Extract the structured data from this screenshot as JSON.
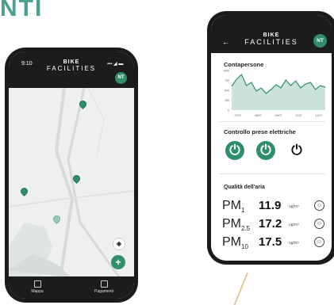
{
  "heading": "NTI",
  "phone1": {
    "time": "9:10",
    "logo_top": "BIKE",
    "logo_bottom": "FACILITIES",
    "avatar": "NT",
    "tabs": [
      {
        "label": "Mappa",
        "icon": "map-icon"
      },
      {
        "label": "Pagamenti",
        "icon": "card-icon"
      }
    ]
  },
  "phone2": {
    "logo_top": "BIKE",
    "logo_bottom": "FACILITIES",
    "avatar": "NT",
    "contapersone": {
      "title": "Contapersone",
      "chart_data": {
        "type": "area",
        "title": "Contapersone",
        "yticks": [
          "1000",
          "750",
          "500",
          "250",
          "0"
        ],
        "xticks": [
          "07/07",
          "08/07",
          "09/07",
          "10/07",
          "11/07"
        ],
        "values": [
          600,
          780,
          900,
          620,
          700,
          480,
          560,
          420,
          520,
          640,
          560,
          760,
          620,
          740,
          560,
          660,
          700,
          520,
          620,
          580
        ],
        "ylim": [
          0,
          1000
        ],
        "color": "#2f8f6b"
      }
    },
    "power": {
      "title": "Controllo prese elettriche",
      "buttons": [
        {
          "state": "on",
          "icon": "power-icon"
        },
        {
          "state": "on",
          "icon": "power-icon"
        },
        {
          "state": "off",
          "icon": "power-icon"
        }
      ]
    },
    "air": {
      "title": "Qualità dell'aria",
      "rows": [
        {
          "label": "PM",
          "sub": "1",
          "value": "11.9",
          "unit": "ug/m³"
        },
        {
          "label": "PM",
          "sub": "2.5",
          "value": "17.2",
          "unit": "ug/m³"
        },
        {
          "label": "PM",
          "sub": "10",
          "value": "17.5",
          "unit": "ug/m³"
        }
      ]
    }
  },
  "colors": {
    "accent": "#2f8f6b",
    "heading": "#4b9f8e"
  }
}
